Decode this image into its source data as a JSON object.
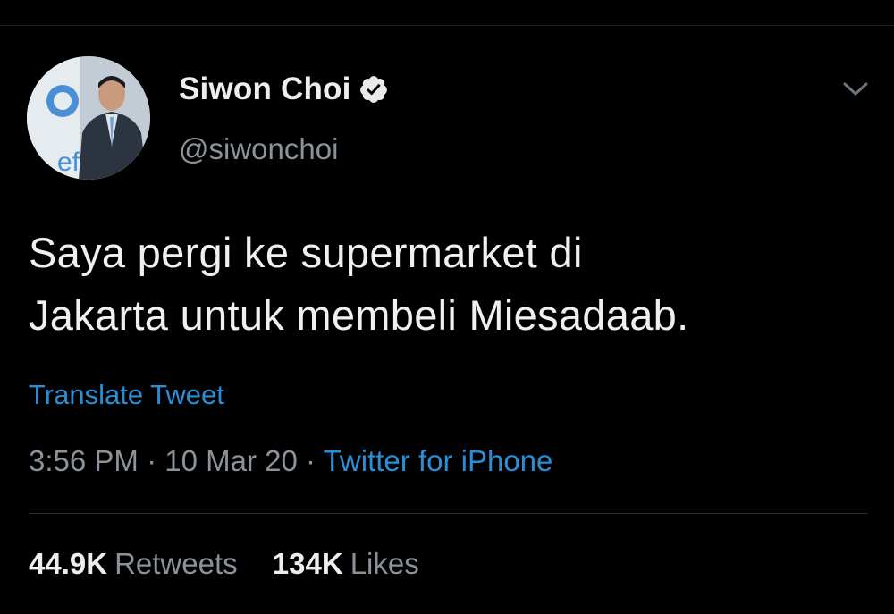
{
  "tweet": {
    "author": {
      "display_name": "Siwon Choi",
      "handle": "@siwonchoi",
      "verified_icon": "verified-badge-icon",
      "avatar_icon": "profile-photo"
    },
    "more_icon": "chevron-down-icon",
    "text_lines": [
      "Saya pergi ke supermarket di",
      "Jakarta untuk membeli Miesadaab."
    ],
    "translate_label": "Translate Tweet",
    "meta": {
      "time": "3:56 PM",
      "separator": "·",
      "date": "10 Mar 20",
      "source": "Twitter for iPhone"
    },
    "stats": {
      "retweets_count": "44.9K",
      "retweets_label": "Retweets",
      "likes_count": "134K",
      "likes_label": "Likes"
    }
  },
  "colors": {
    "background": "#000000",
    "text_primary": "#eef0f1",
    "text_secondary": "#8b9299",
    "link_blue": "#2a8ed6",
    "divider": "#2a2e32"
  }
}
